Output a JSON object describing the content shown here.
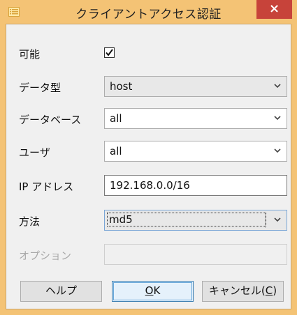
{
  "window": {
    "title": "クライアントアクセス認証",
    "close_glyph": "×",
    "title_bg_color": "#f4c375",
    "close_bg_color": "#c7433a"
  },
  "form": {
    "enabled": {
      "label": "可能",
      "checked": true,
      "check_glyph": "✓"
    },
    "data_type": {
      "label": "データ型",
      "value": "host"
    },
    "database": {
      "label": "データベース",
      "value": "all"
    },
    "user": {
      "label": "ユーザ",
      "value": "all"
    },
    "ip_address": {
      "label": "IP アドレス",
      "value": "192.168.0.0/16"
    },
    "method": {
      "label": "方法",
      "value": "md5"
    },
    "options": {
      "label": "オプション",
      "value": "",
      "disabled": true
    }
  },
  "buttons": {
    "help": "ヘルプ",
    "ok": "OK",
    "ok_mnemonic": "O",
    "ok_rest": "K",
    "cancel_prefix": "キャンセル(",
    "cancel_mnemonic": "C",
    "cancel_suffix": ")"
  }
}
